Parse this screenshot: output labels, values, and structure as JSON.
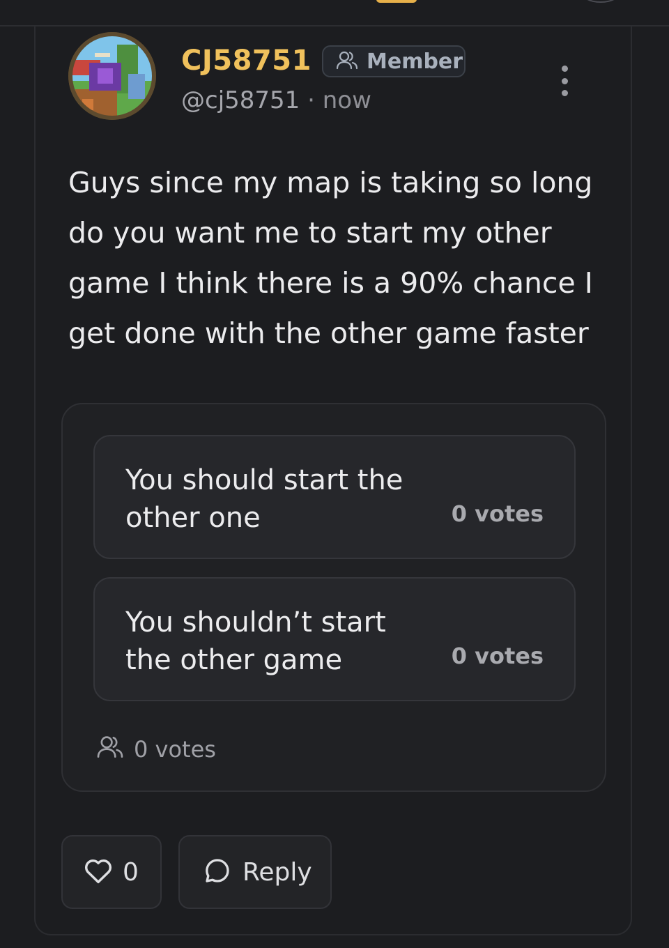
{
  "post": {
    "author": {
      "display_name": "CJ58751",
      "handle": "@cj58751",
      "role": "Member",
      "role_icon": "users-icon",
      "avatar_caption": "CJ58751"
    },
    "separator": "·",
    "timestamp": "now",
    "body": "Guys since my map is taking so long do you want me to start my other game I think there is a 90% chance I get done with the other game faster",
    "menu_icon": "more-vertical-icon"
  },
  "poll": {
    "options": [
      {
        "text": "You should start the other one",
        "votes": "0 votes"
      },
      {
        "text": "You shouldn’t start the other game",
        "votes": "0 votes"
      }
    ],
    "total_icon": "users-icon",
    "total_votes": "0 votes"
  },
  "actions": {
    "like_icon": "heart-icon",
    "like_count": "0",
    "reply_icon": "chat-bubble-icon",
    "reply_label": "Reply"
  },
  "colors": {
    "background": "#1c1d20",
    "username": "#f0c15c",
    "accent": "#e6b04a"
  }
}
